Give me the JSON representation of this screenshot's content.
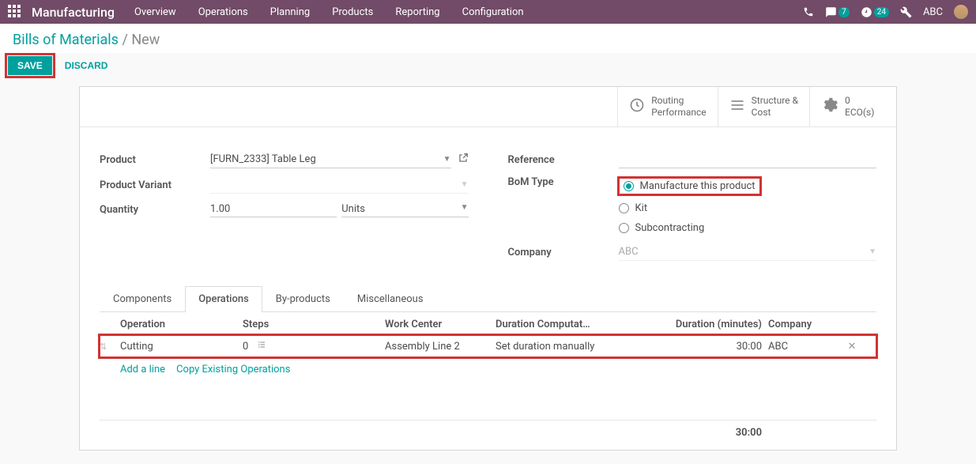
{
  "nav": {
    "app": "Manufacturing",
    "menu": [
      "Overview",
      "Operations",
      "Planning",
      "Products",
      "Reporting",
      "Configuration"
    ],
    "chat_badge": "7",
    "clock_badge": "24",
    "user": "ABC"
  },
  "breadcrumb": {
    "parent": "Bills of Materials",
    "current": "New"
  },
  "actions": {
    "save": "SAVE",
    "discard": "DISCARD"
  },
  "stat_buttons": [
    {
      "line1": "Routing",
      "line2": "Performance"
    },
    {
      "line1": "Structure &",
      "line2": "Cost"
    },
    {
      "line1": "0",
      "line2": "ECO(s)"
    }
  ],
  "form": {
    "product_label": "Product",
    "product_value": "[FURN_2333] Table Leg",
    "variant_label": "Product Variant",
    "variant_value": "",
    "qty_label": "Quantity",
    "qty_value": "1.00",
    "qty_uom": "Units",
    "reference_label": "Reference",
    "bom_type_label": "BoM Type",
    "bom_types": [
      "Manufacture this product",
      "Kit",
      "Subcontracting"
    ],
    "bom_type_selected": 0,
    "company_label": "Company",
    "company_value": "ABC"
  },
  "tabs": [
    "Components",
    "Operations",
    "By-products",
    "Miscellaneous"
  ],
  "active_tab": 1,
  "op_table": {
    "headers": {
      "operation": "Operation",
      "steps": "Steps",
      "wc": "Work Center",
      "dc": "Duration Computat…",
      "dur": "Duration (minutes)",
      "co": "Company"
    },
    "rows": [
      {
        "operation": "Cutting",
        "steps": "0",
        "wc": "Assembly Line 2",
        "dc": "Set duration manually",
        "dur": "30:00",
        "co": "ABC"
      }
    ],
    "add_line": "Add a line",
    "copy": "Copy Existing Operations",
    "total": "30:00"
  }
}
